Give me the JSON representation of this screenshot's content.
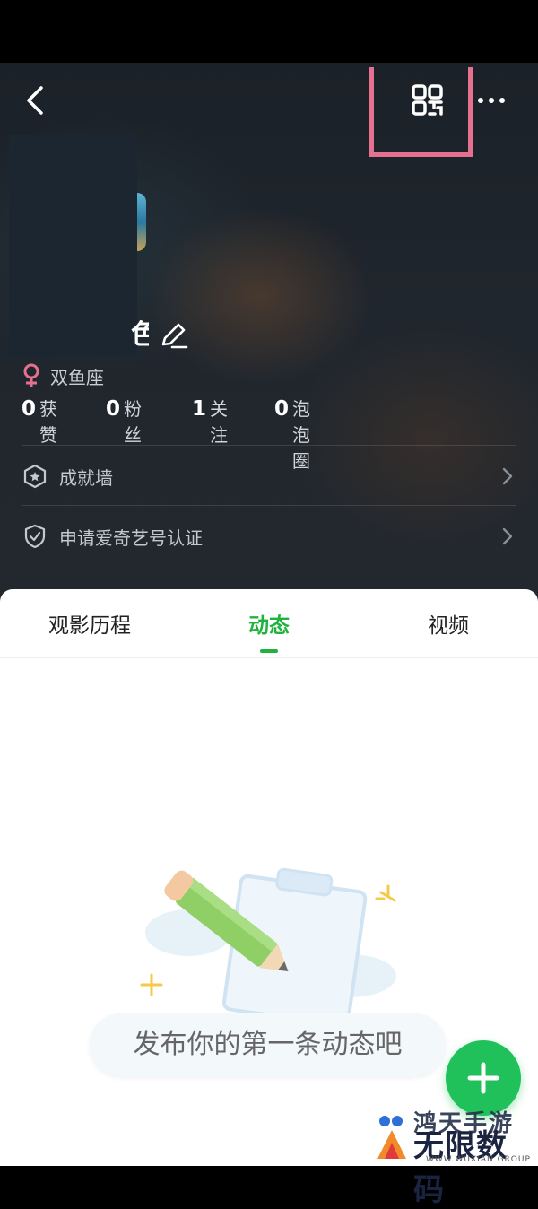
{
  "header": {
    "name_fragment": "色",
    "zodiac": "双鱼座",
    "stats": [
      {
        "num": "0",
        "label": "获赞"
      },
      {
        "num": "0",
        "label": "粉丝"
      },
      {
        "num": "1",
        "label": "关注"
      },
      {
        "num": "0",
        "label": "泡泡圈"
      }
    ],
    "rows": [
      {
        "label": "成就墙",
        "icon": "achievement-hexagon-icon"
      },
      {
        "label": "申请爱奇艺号认证",
        "icon": "shield-check-icon"
      }
    ]
  },
  "tabs": {
    "history": "观影历程",
    "feed": "动态",
    "video": "视频",
    "active": "动态"
  },
  "empty_state": {
    "message": "发布你的第一条动态吧",
    "illustration": "pencil-clipboard-illustration"
  },
  "watermark": {
    "top": "鸿天手游",
    "main": "无限数码",
    "sub": "WWW.WUXIAN GROUP"
  },
  "colors": {
    "accent": "#1fb33d",
    "fab": "#20c15a",
    "highlight": "#e5708f",
    "header_bg": "#20262d",
    "female_icon": "#e5708f"
  }
}
